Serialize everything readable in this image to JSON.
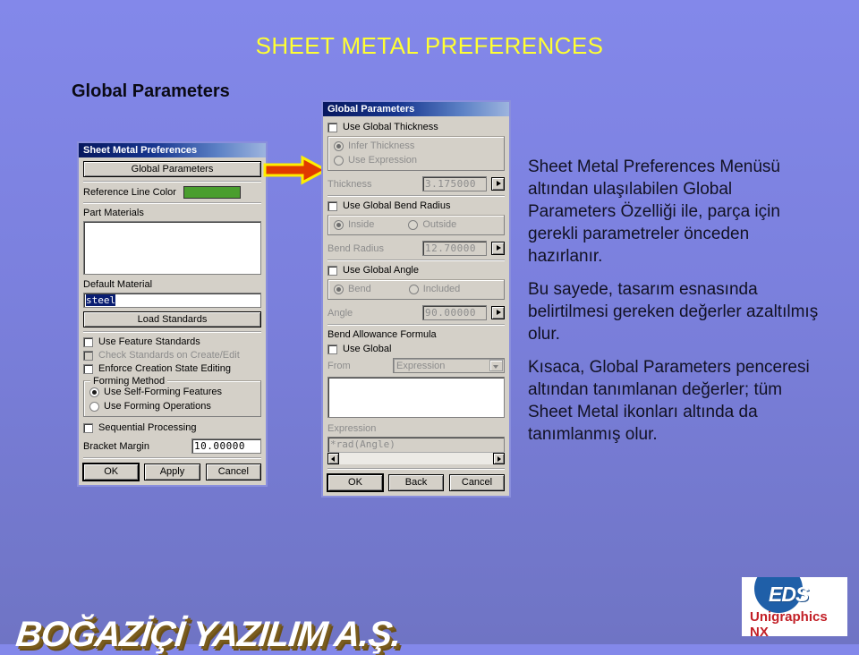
{
  "slide": {
    "title": "SHEET METAL PREFERENCES",
    "section_heading": "Global Parameters",
    "title_color": "#ffff33",
    "background_top": "#8388ea",
    "background_bottom": "#6f74c4"
  },
  "arrow": {
    "name": "right-arrow",
    "fill": "#e03a00",
    "stroke": "#ffee00"
  },
  "left_dialog": {
    "title": "Sheet Metal Preferences",
    "global_parameters_button": "Global Parameters",
    "reference_line_color_label": "Reference Line Color",
    "reference_line_color_value": "#4a9e2e",
    "part_materials_label": "Part Materials",
    "part_materials_items": [],
    "default_material_label": "Default Material",
    "default_material_value": "steel",
    "load_standards_button": "Load Standards",
    "checkboxes": [
      {
        "label": "Use Feature Standards",
        "checked": false,
        "enabled": true
      },
      {
        "label": "Check Standards on Create/Edit",
        "checked": false,
        "enabled": false
      },
      {
        "label": "Enforce Creation State Editing",
        "checked": false,
        "enabled": true
      }
    ],
    "forming_method": {
      "legend": "Forming Method",
      "options": [
        {
          "label": "Use Self-Forming Features",
          "selected": true
        },
        {
          "label": "Use Forming Operations",
          "selected": false
        }
      ]
    },
    "sequential_processing": {
      "label": "Sequential Processing",
      "checked": false
    },
    "bracket_margin_label": "Bracket Margin",
    "bracket_margin_value": "10.00000",
    "buttons": [
      "OK",
      "Apply",
      "Cancel"
    ]
  },
  "right_dialog": {
    "title": "Global Parameters",
    "thickness_group": {
      "checkbox_label": "Use Global Thickness",
      "checked": false,
      "options": [
        {
          "label": "Infer Thickness",
          "selected": true
        },
        {
          "label": "Use Expression",
          "selected": false
        }
      ],
      "field_label": "Thickness",
      "field_value": "3.175000"
    },
    "bend_radius_group": {
      "checkbox_label": "Use Global Bend Radius",
      "checked": false,
      "options": [
        {
          "label": "Inside",
          "selected": true
        },
        {
          "label": "Outside",
          "selected": false
        }
      ],
      "field_label": "Bend Radius",
      "field_value": "12.70000"
    },
    "angle_group": {
      "checkbox_label": "Use Global Angle",
      "checked": false,
      "options": [
        {
          "label": "Bend",
          "selected": true
        },
        {
          "label": "Included",
          "selected": false
        }
      ],
      "field_label": "Angle",
      "field_value": "90.00000"
    },
    "bend_allowance": {
      "heading": "Bend Allowance Formula",
      "checkbox_label": "Use Global",
      "checked": false,
      "from_label": "From",
      "from_value": "Expression",
      "list_items": [],
      "expression_label": "Expression",
      "expression_value": "*rad(Angle)"
    },
    "buttons": [
      "OK",
      "Back",
      "Cancel"
    ]
  },
  "body_text": {
    "paragraph_1": "Sheet Metal Preferences Menüsü altından ulaşılabilen Global Parameters Özelliği ile, parça için gerekli parametreler önceden hazırlanır.",
    "paragraph_2": "Bu sayede, tasarım esnasında belirtilmesi gereken değerler azaltılmış olur.",
    "paragraph_3": "Kısaca, Global Parameters penceresi altından tanımlanan değerler; tüm Sheet Metal ikonları altında da tanımlanmış olur."
  },
  "logo": {
    "brand": "EDS",
    "product": "Unigraphics NX",
    "circle_color": "#1f5fa8",
    "product_color": "#c21f26"
  },
  "watermark": {
    "text": "BOĞAZİÇİ YAZILIM A.Ş."
  }
}
